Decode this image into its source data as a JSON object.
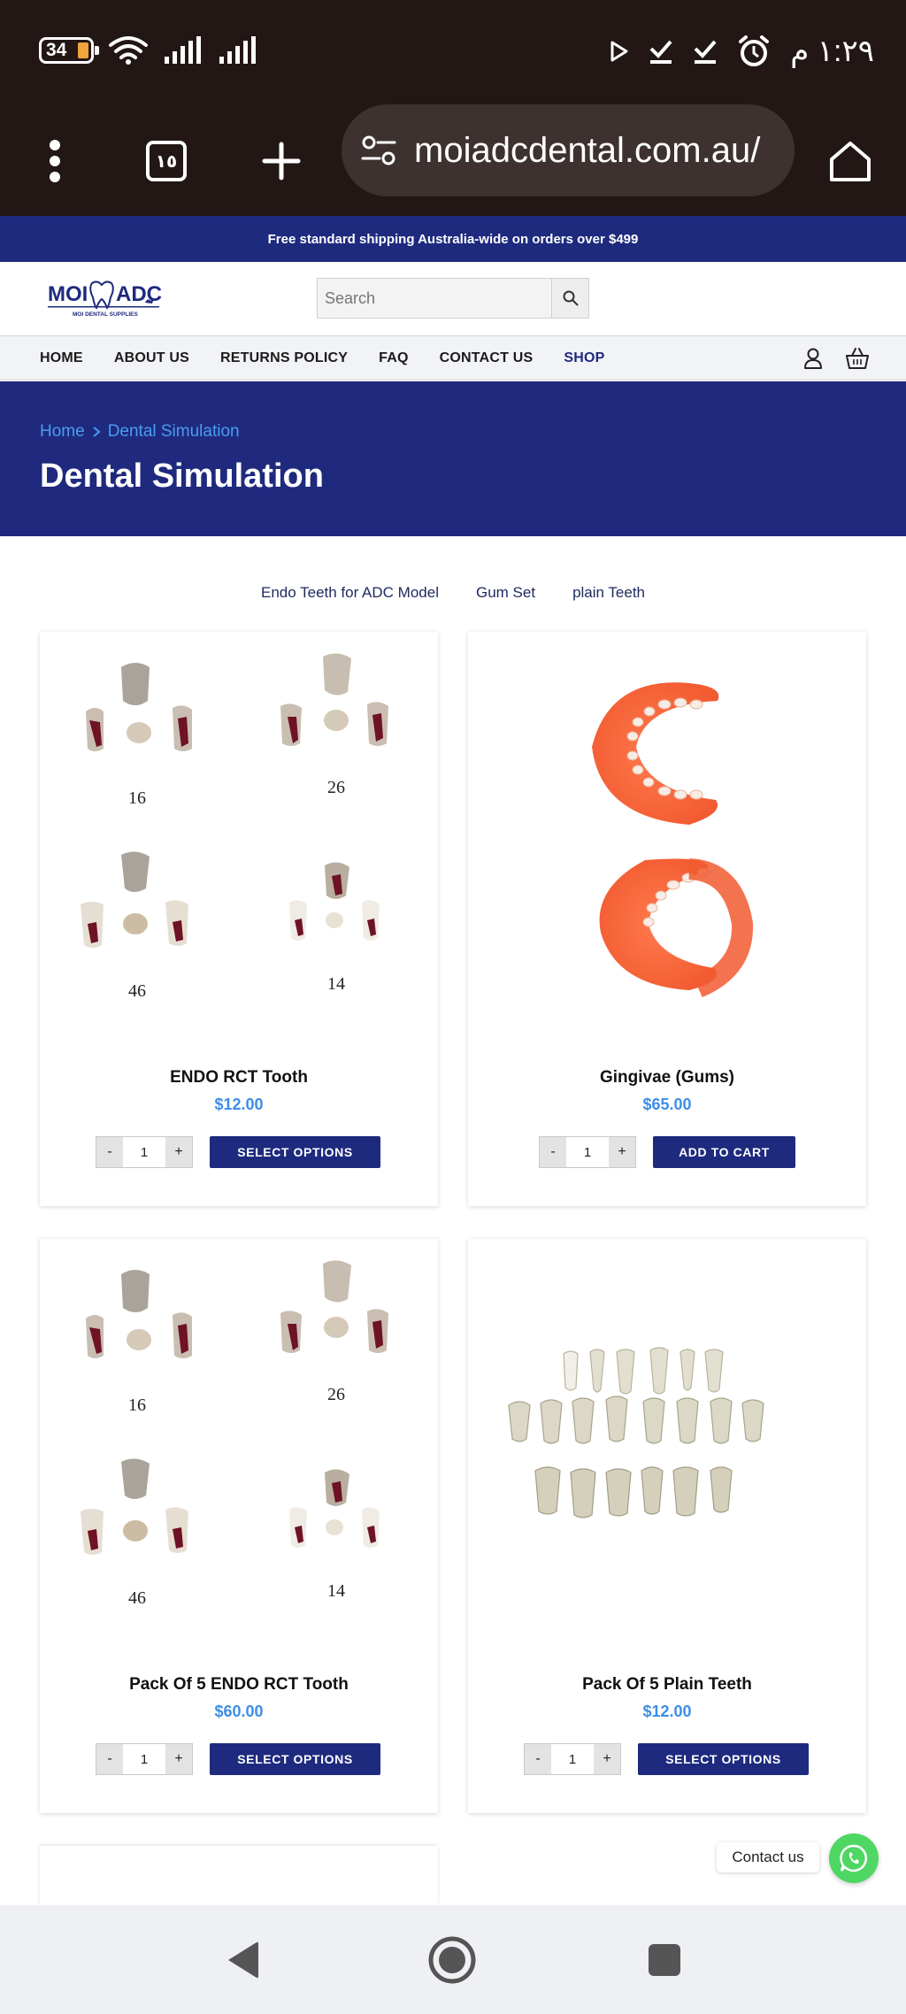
{
  "status_bar": {
    "battery": "34",
    "time": "١:٢٩ م"
  },
  "browser": {
    "tab_count": "١٥",
    "url": "moiadcdental.com.au/"
  },
  "promo_bar": {
    "text": "Free standard shipping Australia-wide on orders over $499"
  },
  "header": {
    "logo_text": "MOI ADC",
    "logo_tagline": "MOI DENTAL SUPPLIES",
    "search_placeholder": "Search"
  },
  "nav": {
    "items": [
      {
        "label": "HOME"
      },
      {
        "label": "ABOUT US"
      },
      {
        "label": "RETURNS POLICY"
      },
      {
        "label": "FAQ"
      },
      {
        "label": "CONTACT US"
      },
      {
        "label": "SHOP"
      }
    ]
  },
  "hero": {
    "breadcrumb": [
      "Home",
      "Dental Simulation"
    ],
    "title": "Dental Simulation"
  },
  "categories": [
    "Endo Teeth for ADC Model",
    "Gum Set",
    "plain Teeth"
  ],
  "products": [
    {
      "name": "ENDO RCT Tooth",
      "price": "$12.00",
      "qty": "1",
      "button": "SELECT OPTIONS",
      "image_labels": [
        "16",
        "26",
        "46",
        "14"
      ]
    },
    {
      "name": "Gingivae (Gums)",
      "price": "$65.00",
      "qty": "1",
      "button": "ADD TO CART"
    },
    {
      "name": "Pack Of 5 ENDO RCT Tooth",
      "price": "$60.00",
      "qty": "1",
      "button": "SELECT OPTIONS",
      "image_labels": [
        "16",
        "26",
        "46",
        "14"
      ]
    },
    {
      "name": "Pack Of 5 Plain Teeth",
      "price": "$12.00",
      "qty": "1",
      "button": "SELECT OPTIONS"
    }
  ],
  "qty_controls": {
    "minus": "-",
    "plus": "+"
  },
  "contact": {
    "label": "Contact us"
  },
  "colors": {
    "brand_navy": "#1e2a7e",
    "link_blue": "#4a9cf0",
    "price_blue": "#3d8ee6",
    "whatsapp_green": "#4ed763",
    "status_bg": "#231715"
  }
}
